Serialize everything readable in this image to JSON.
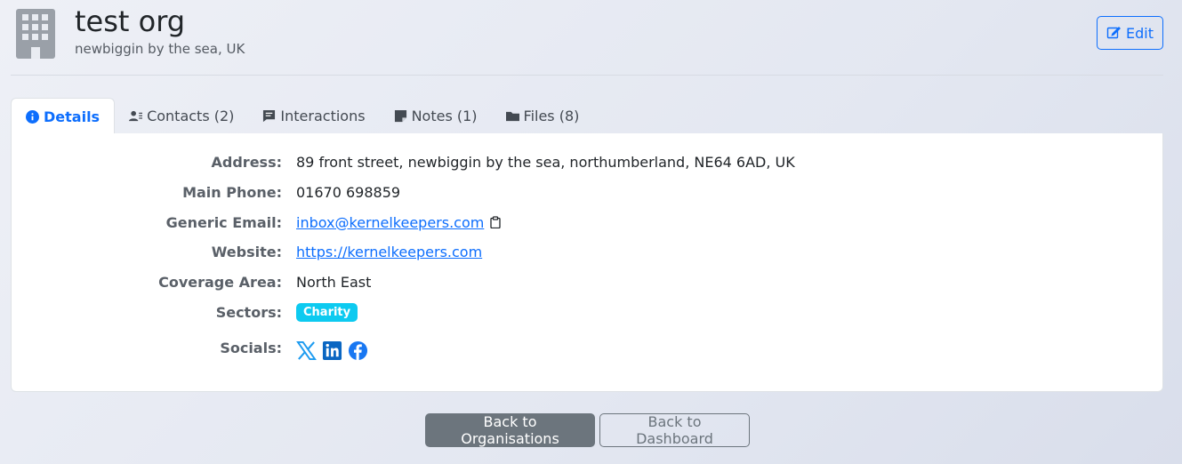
{
  "org": {
    "name": "test org",
    "location": "newbiggin by the sea, UK",
    "icon": "building-icon"
  },
  "header": {
    "edit_label": "Edit"
  },
  "tabs": [
    {
      "label": "Details",
      "icon": "info-icon",
      "active": true
    },
    {
      "label": "Contacts (2)",
      "icon": "contacts-icon"
    },
    {
      "label": "Interactions",
      "icon": "chat-icon"
    },
    {
      "label": "Notes (1)",
      "icon": "note-icon"
    },
    {
      "label": "Files (8)",
      "icon": "folder-icon"
    }
  ],
  "details": {
    "address_label": "Address:",
    "address": "89 front street, newbiggin by the sea, northumberland, NE64 6AD, UK",
    "phone_label": "Main Phone:",
    "phone": "01670 698859",
    "email_label": "Generic Email:",
    "email": "inbox@kernelkeepers.com",
    "website_label": "Website:",
    "website": "https://kernelkeepers.com",
    "coverage_label": "Coverage Area:",
    "coverage": "North East",
    "sectors_label": "Sectors:",
    "sectors": [
      "Charity"
    ],
    "socials_label": "Socials:",
    "socials": [
      "x-icon",
      "linkedin-icon",
      "facebook-icon"
    ]
  },
  "actions": {
    "back_orgs": "Back to Organisations",
    "back_dashboard": "Back to Dashboard"
  },
  "colors": {
    "primary": "#0d6efd",
    "badge": "#0dcaf0",
    "secondary": "#6c757d",
    "x_brand": "#1d9bf0",
    "linkedin_brand": "#0a66c2",
    "facebook_brand": "#1877f2"
  }
}
